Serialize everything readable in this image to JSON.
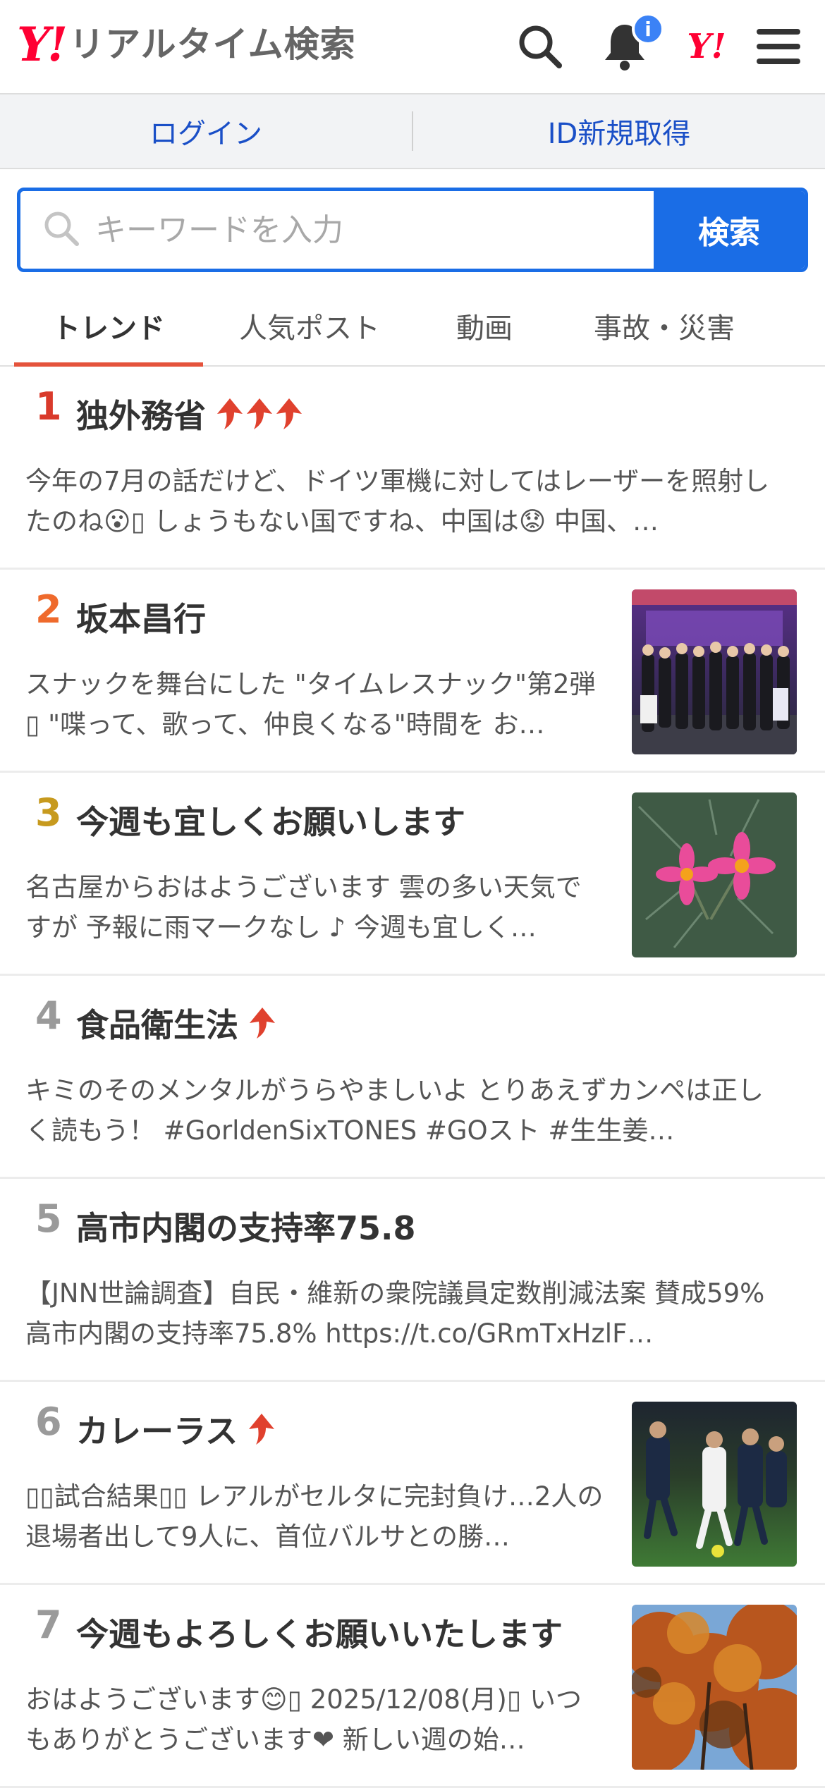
{
  "header": {
    "logo_mark": "Y!",
    "logo_text": "リアルタイム検索",
    "notification_badge": "i",
    "yahoo_mark": "Y!"
  },
  "login": {
    "login_label": "ログイン",
    "register_label": "ID新規取得"
  },
  "search": {
    "placeholder": "キーワードを入力",
    "value": "",
    "button_label": "検索"
  },
  "tabs": [
    {
      "label": "トレンド",
      "active": true
    },
    {
      "label": "人気ポスト",
      "active": false
    },
    {
      "label": "動画",
      "active": false
    },
    {
      "label": "事故・災害",
      "active": false
    }
  ],
  "colors": {
    "brand_red": "#ff0033",
    "accent_blue": "#1a6de6",
    "rank1": "#d93a2b",
    "rank2": "#ef6a2c",
    "rank3": "#c79a1e",
    "rank_other": "#9a9a9a",
    "trend_arrow": "#e0412e"
  },
  "trends": [
    {
      "rank": "1",
      "title": "独外務省",
      "arrows": 3,
      "thumbnail": null,
      "description": "今年の7月の話だけど、ドイツ軍機に対してはレーザーを照射したのね😮▯ しょうもない国ですね、中国は😟 中国、…"
    },
    {
      "rank": "2",
      "title": "坂本昌行",
      "arrows": 0,
      "thumbnail": "stage-group-photo",
      "description": "スナックを舞台にした \"タイムレスナック\"第2弾▯ \"喋って、歌って、仲良くなる\"時間を お…"
    },
    {
      "rank": "3",
      "title": "今週も宜しくお願いします",
      "arrows": 0,
      "thumbnail": "pink-flowers-photo",
      "description": "名古屋からおはようございます 雲の多い天気ですが 予報に雨マークなし ♪ 今週も宜しく…"
    },
    {
      "rank": "4",
      "title": "食品衛生法",
      "arrows": 1,
      "thumbnail": null,
      "description": "キミのそのメンタルがうらやましいよ とりあえずカンペは正しく読もう！ #GorldenSixTONES #GOスト #生生姜…"
    },
    {
      "rank": "5",
      "title": "高市内閣の支持率75.8",
      "arrows": 0,
      "thumbnail": null,
      "description": "【JNN世論調査】自民・維新の衆院議員定数削減法案 賛成59% 高市内閣の支持率75.8% https://t.co/GRmTxHzlF…"
    },
    {
      "rank": "6",
      "title": "カレーラス",
      "arrows": 1,
      "thumbnail": "soccer-match-photo",
      "description": "▯▯試合結果▯▯ レアルがセルタに完封負け…2人の退場者出して9人に、首位バルサとの勝…"
    },
    {
      "rank": "7",
      "title": "今週もよろしくお願いいたします",
      "arrows": 0,
      "thumbnail": "autumn-leaves-photo",
      "description": "おはようございます😊▯ 2025/12/08(月)▯ いつもありがとうございます❤ 新しい週の始…"
    }
  ]
}
